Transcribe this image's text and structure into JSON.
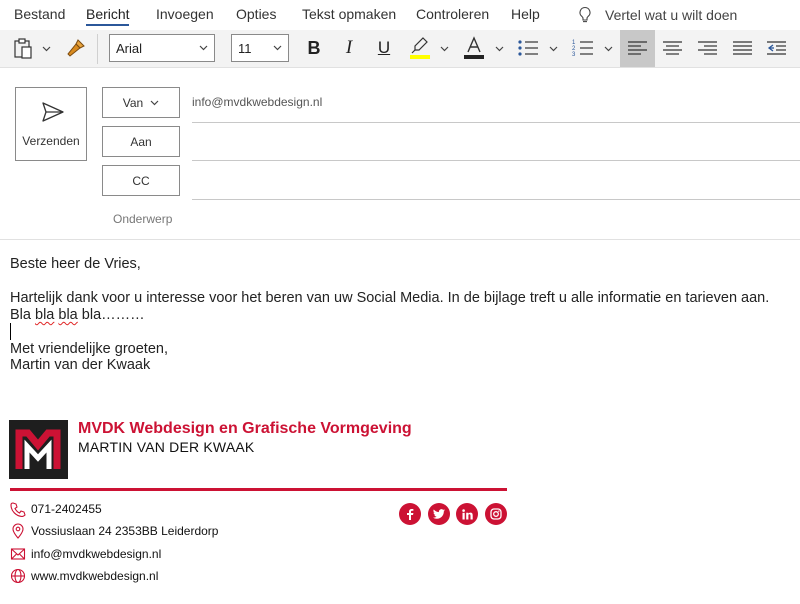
{
  "menu": {
    "tabs": [
      {
        "label": "Bestand"
      },
      {
        "label": "Bericht"
      },
      {
        "label": "Invoegen"
      },
      {
        "label": "Opties"
      },
      {
        "label": "Tekst opmaken"
      },
      {
        "label": "Controleren"
      },
      {
        "label": "Help"
      }
    ],
    "active_tab": "Bericht",
    "tell_me": "Vertel wat u wilt doen"
  },
  "toolbar": {
    "font_name": "Arial",
    "font_size": "11",
    "bold_label": "B",
    "italic_label": "I",
    "underline_label": "U",
    "highlight_color": "#ffff00",
    "font_color": "#222222",
    "active_alignment": "align-left"
  },
  "compose": {
    "send_label": "Verzenden",
    "from_label": "Van",
    "from_value": "info@mvdkwebdesign.nl",
    "to_label": "Aan",
    "cc_label": "CC",
    "subject_label": "Onderwerp"
  },
  "body": {
    "greeting": "Beste heer de Vries,",
    "paragraph": "Hartelijk dank voor u interesse voor het beren van uw Social Media. In de bijlage treft u alle informatie en tarieven aan.",
    "bla_1": "Bla",
    "bla_2": "bla",
    "bla_3": "bla",
    "bla_tail": "bla………",
    "closing": "Met vriendelijke groeten,",
    "sender": "Martin van der Kwaak"
  },
  "signature": {
    "company": "MVDK Webdesign en Grafische Vormgeving",
    "name": "MARTIN VAN DER KWAAK",
    "phone": "071-2402455",
    "address": "Vossiuslaan 24 2353BB Leiderdorp",
    "email": "info@mvdkwebdesign.nl",
    "website": "www.mvdkwebdesign.nl",
    "brand_color": "#cc1234",
    "social": [
      "facebook-icon",
      "twitter-icon",
      "linkedin-icon",
      "instagram-icon"
    ]
  }
}
